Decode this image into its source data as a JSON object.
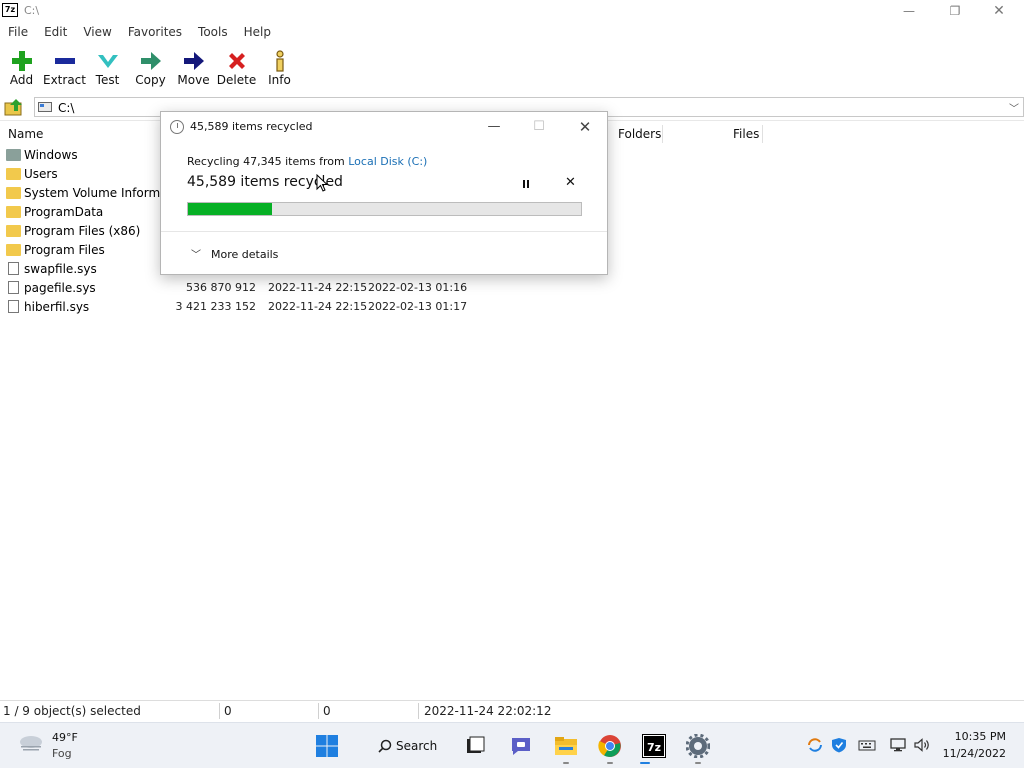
{
  "window": {
    "title": "C:\\",
    "app_icon_label": "7z",
    "minimize": "—",
    "maximize": "❐",
    "close": "✕"
  },
  "menu": [
    "File",
    "Edit",
    "View",
    "Favorites",
    "Tools",
    "Help"
  ],
  "toolbar": [
    {
      "label": "Add",
      "icon": "plus-icon",
      "color": "#1fa21f"
    },
    {
      "label": "Extract",
      "icon": "minus-icon",
      "color": "#1a2a9c"
    },
    {
      "label": "Test",
      "icon": "check-icon",
      "color": "#33c0c0"
    },
    {
      "label": "Copy",
      "icon": "copy-arrow-icon",
      "color": "#2f8f6a"
    },
    {
      "label": "Move",
      "icon": "move-arrow-icon",
      "color": "#14187a"
    },
    {
      "label": "Delete",
      "icon": "delete-x-icon",
      "color": "#d62020"
    },
    {
      "label": "Info",
      "icon": "info-icon",
      "color": "#7a5a10"
    }
  ],
  "address": {
    "path": "C:\\"
  },
  "columns": {
    "name": "Name",
    "folders": "Folders",
    "files": "Files"
  },
  "files": [
    {
      "name": "Windows",
      "type": "folder-gray",
      "size": "",
      "modified": "",
      "created": ""
    },
    {
      "name": "Users",
      "type": "folder",
      "size": "",
      "modified": "",
      "created": ""
    },
    {
      "name": "System Volume Informa...",
      "type": "folder",
      "size": "",
      "modified": "",
      "created": ""
    },
    {
      "name": "ProgramData",
      "type": "folder",
      "size": "",
      "modified": "",
      "created": ""
    },
    {
      "name": "Program Files (x86)",
      "type": "folder",
      "size": "",
      "modified": "",
      "created": ""
    },
    {
      "name": "Program Files",
      "type": "folder",
      "size": "",
      "modified": "",
      "created": ""
    },
    {
      "name": "swapfile.sys",
      "type": "file",
      "size": "",
      "modified": "",
      "created": ""
    },
    {
      "name": "pagefile.sys",
      "type": "file",
      "size": "536 870 912",
      "modified": "2022-11-24 22:15",
      "created": "2022-02-13 01:16"
    },
    {
      "name": "hiberfil.sys",
      "type": "file",
      "size": "3 421 233 152",
      "modified": "2022-11-24 22:15",
      "created": "2022-02-13 01:17"
    }
  ],
  "status": {
    "selected": "1 / 9 object(s) selected",
    "size1": "0",
    "size2": "0",
    "datetime": "2022-11-24 22:02:12"
  },
  "dialog": {
    "title": "45,589 items recycled",
    "line1_prefix": "Recycling 47,345 items from ",
    "line1_link": "Local Disk (C:)",
    "line2": "45,589 items recycled",
    "progress": 0.213,
    "more_details": "More details",
    "minimize": "—",
    "maximize": "☐",
    "close": "✕",
    "cancel": "✕"
  },
  "taskbar": {
    "weather_temp": "49°F",
    "weather_cond": "Fog",
    "search_label": "Search",
    "time": "10:35 PM",
    "date": "11/24/2022",
    "apps": [
      "start-icon",
      "search-icon",
      "task-view-icon",
      "teams-chat-icon",
      "file-explorer-icon",
      "chrome-icon",
      "7zip-icon",
      "settings-icon"
    ]
  }
}
